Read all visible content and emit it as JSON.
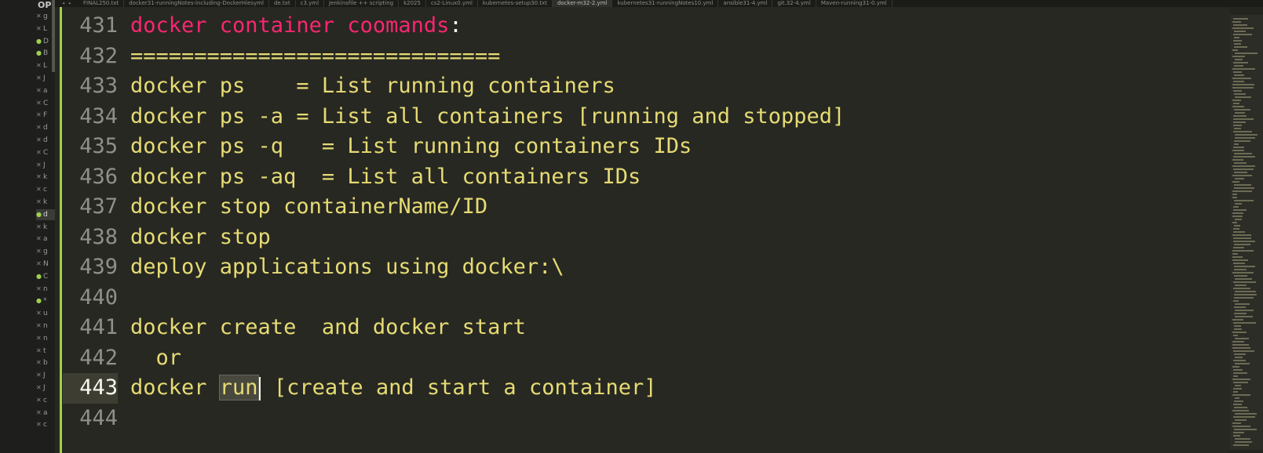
{
  "sidebar": {
    "header": "OP",
    "items": [
      {
        "marker": "x",
        "label": "g"
      },
      {
        "marker": "x",
        "label": "L"
      },
      {
        "marker": "dot",
        "label": "D"
      },
      {
        "marker": "dot",
        "label": "B"
      },
      {
        "marker": "x",
        "label": "L"
      },
      {
        "marker": "x",
        "label": "J"
      },
      {
        "marker": "x",
        "label": "a"
      },
      {
        "marker": "x",
        "label": "C"
      },
      {
        "marker": "x",
        "label": "F"
      },
      {
        "marker": "x",
        "label": "d"
      },
      {
        "marker": "x",
        "label": "d"
      },
      {
        "marker": "x",
        "label": "C"
      },
      {
        "marker": "x",
        "label": "J"
      },
      {
        "marker": "x",
        "label": "k"
      },
      {
        "marker": "x",
        "label": "c"
      },
      {
        "marker": "x",
        "label": "k"
      },
      {
        "marker": "dot",
        "label": "d"
      },
      {
        "marker": "x",
        "label": "k"
      },
      {
        "marker": "x",
        "label": "a"
      },
      {
        "marker": "x",
        "label": "g"
      },
      {
        "marker": "x",
        "label": "N"
      },
      {
        "marker": "dot",
        "label": "C"
      },
      {
        "marker": "x",
        "label": "n"
      },
      {
        "marker": "dot",
        "label": "*"
      },
      {
        "marker": "x",
        "label": "u"
      },
      {
        "marker": "x",
        "label": "n"
      },
      {
        "marker": "x",
        "label": "n"
      },
      {
        "marker": "x",
        "label": "t"
      },
      {
        "marker": "x",
        "label": "b"
      },
      {
        "marker": "x",
        "label": "J"
      },
      {
        "marker": "x",
        "label": "J"
      },
      {
        "marker": "x",
        "label": "c"
      },
      {
        "marker": "x",
        "label": "a"
      },
      {
        "marker": "x",
        "label": "c"
      }
    ]
  },
  "tabs": [
    {
      "label": "FINAL250.txt"
    },
    {
      "label": "docker31-runningNotes-including-DockerHiesyml"
    },
    {
      "label": "de.txt"
    },
    {
      "label": "c3.yml"
    },
    {
      "label": "Jenkinsfile ++ scripting"
    },
    {
      "label": "k2025"
    },
    {
      "label": "cs2-Linux0.yml"
    },
    {
      "label": "kubernetes-setup30.txt"
    },
    {
      "label": "docker-m32-2.yml"
    },
    {
      "label": "kubernetes31-runningNotes10.yml"
    },
    {
      "label": "ansible31-4.yml"
    },
    {
      "label": "git.32-4.yml"
    },
    {
      "label": "Maven-running31-0.yml"
    }
  ],
  "editor": {
    "heading": {
      "number": "431",
      "text": "docker container coomands",
      "colon": ":"
    },
    "lines": [
      {
        "number": "432",
        "text": "============================="
      },
      {
        "number": "433",
        "text": "docker ps    = List running containers"
      },
      {
        "number": "434",
        "text": "docker ps -a = List all containers [running and stopped]"
      },
      {
        "number": "435",
        "text": "docker ps -q   = List running containers IDs"
      },
      {
        "number": "436",
        "text": "docker ps -aq  = List all containers IDs"
      },
      {
        "number": "437",
        "text": "docker stop containerName/ID"
      },
      {
        "number": "438",
        "text": "docker stop"
      },
      {
        "number": "439",
        "text": "deploy applications using docker:\\"
      },
      {
        "number": "440",
        "text": ""
      },
      {
        "number": "441",
        "text": "docker create  and docker start"
      },
      {
        "number": "442",
        "text": "  or"
      }
    ],
    "current": {
      "number": "443",
      "before": "docker ",
      "selected": "run",
      "after": " [create and start a container]"
    },
    "last": {
      "number": "444",
      "text": ""
    }
  }
}
